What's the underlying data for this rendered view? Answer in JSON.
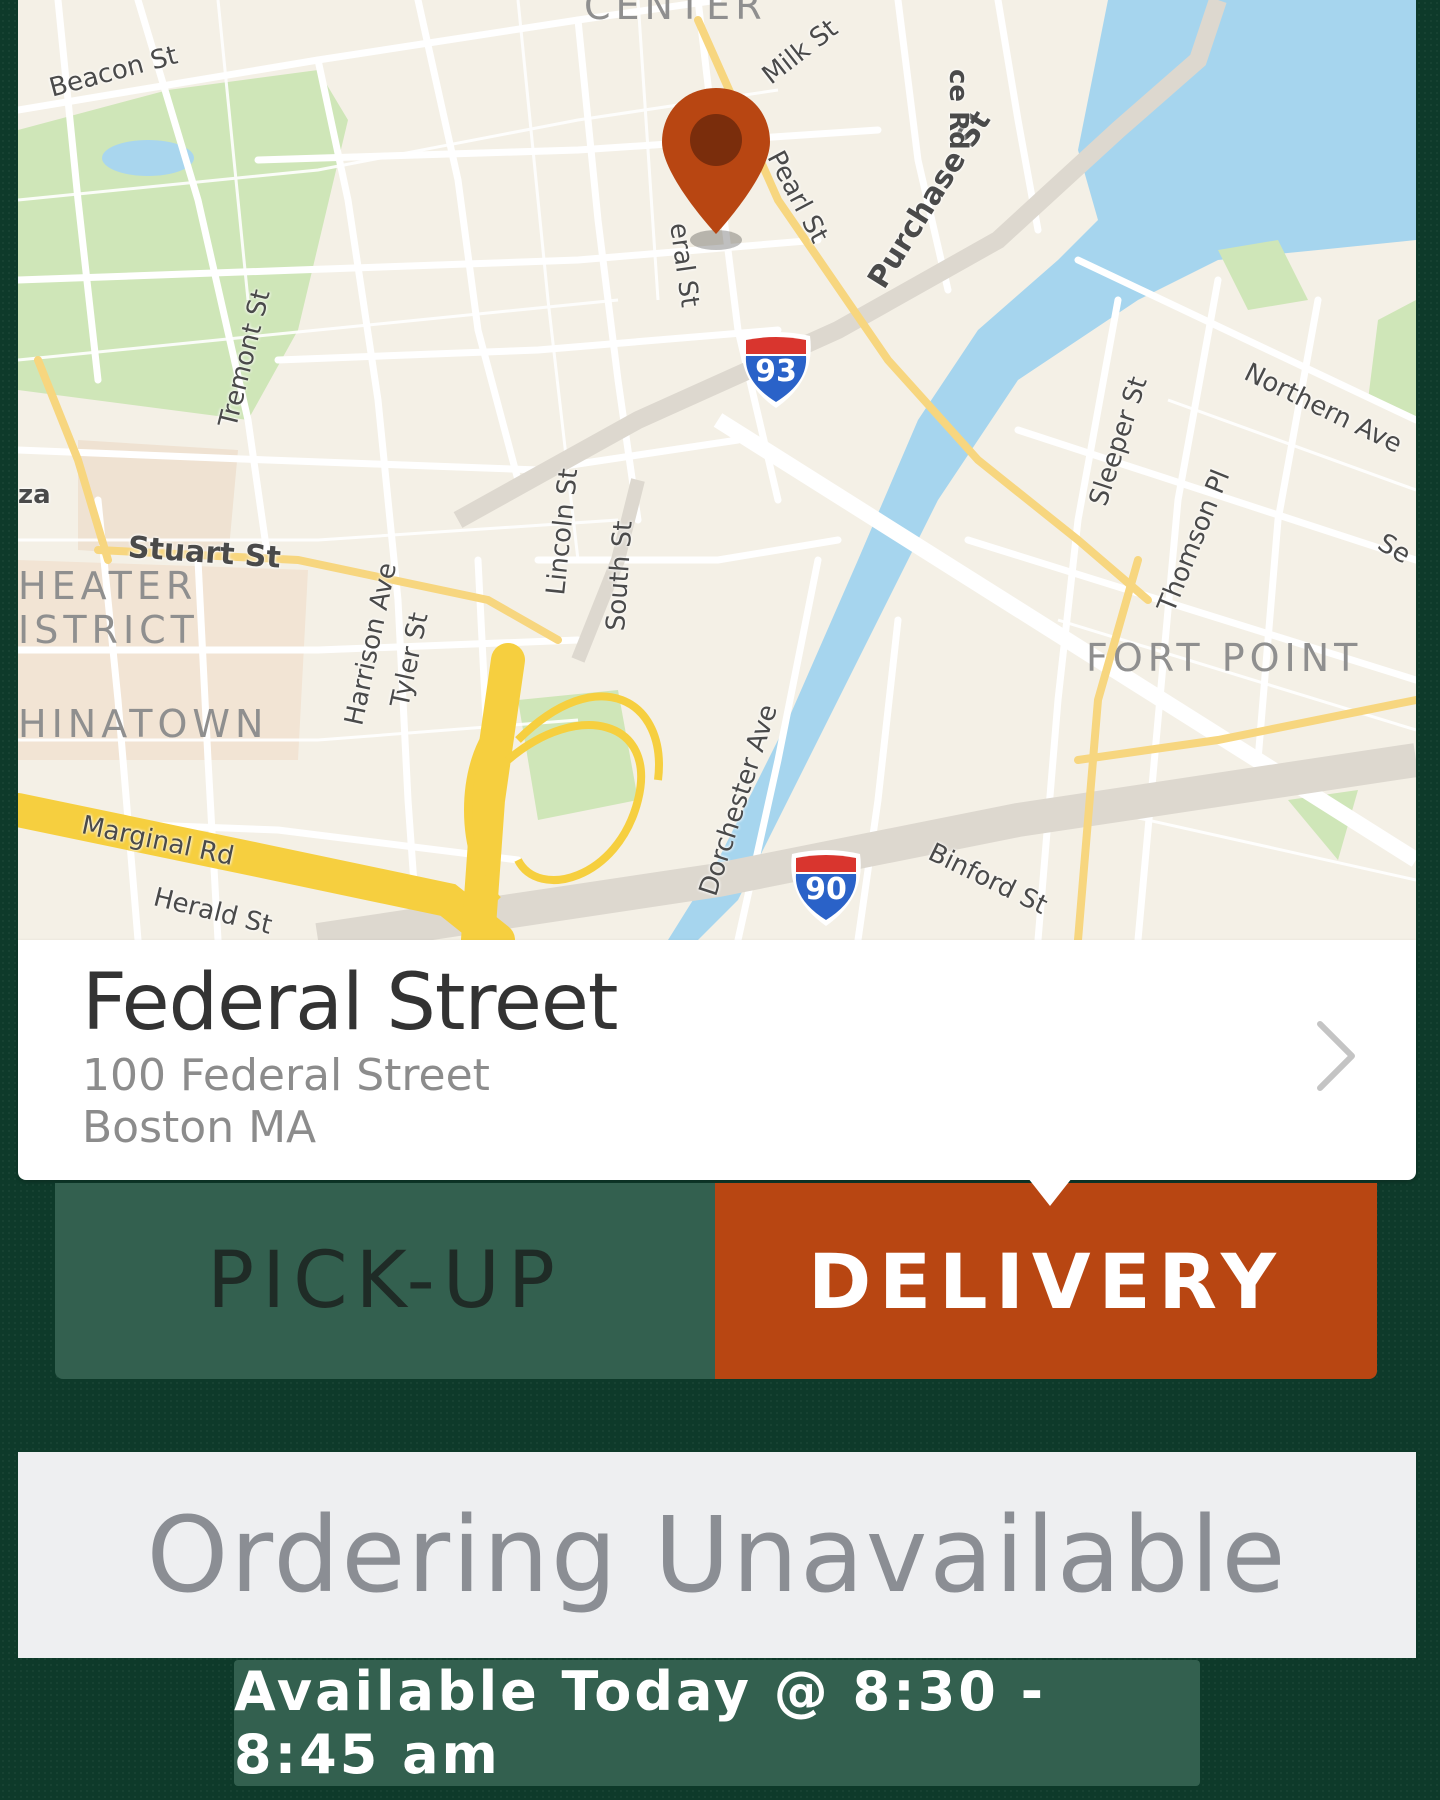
{
  "map": {
    "street_labels": {
      "beacon": "Beacon St",
      "milk": "Milk St",
      "pearl": "Pearl St",
      "purchase": "Purchase St",
      "federal": "eral St",
      "tremont": "Tremont St",
      "stuart": "Stuart St",
      "lincoln": "Lincoln St",
      "south": "South St",
      "harrison": "Harrison Ave",
      "tyler": "Tyler St",
      "sleeper": "Sleeper St",
      "northern": "Northern Ave",
      "thomson": "Thomson Pl",
      "dorchester": "Dorchester Ave",
      "binford": "Binford St",
      "marginal": "Marginal Rd",
      "herald": "Herald St",
      "ce_rd": "ce Rd",
      "plaza": "za",
      "se": "Se"
    },
    "districts": {
      "center": "CENTER",
      "theater_1": "HEATER",
      "theater_2": "ISTRICT",
      "chinatown": "HINATOWN",
      "fort_point": "FORT POINT"
    },
    "shields": {
      "i93": "93",
      "i90": "90"
    }
  },
  "location": {
    "name": "Federal Street",
    "address_line1": "100 Federal Street",
    "address_line2": "Boston MA"
  },
  "mode": {
    "pickup_label": "PICK-UP",
    "delivery_label": "DELIVERY",
    "selected": "delivery"
  },
  "ordering": {
    "status_label": "Ordering Unavailable",
    "availability": "Available Today @ 8:30 - 8:45 am"
  },
  "colors": {
    "accent": "#b84612",
    "background": "#0e3a2a",
    "toggle_inactive": "#33604f"
  }
}
